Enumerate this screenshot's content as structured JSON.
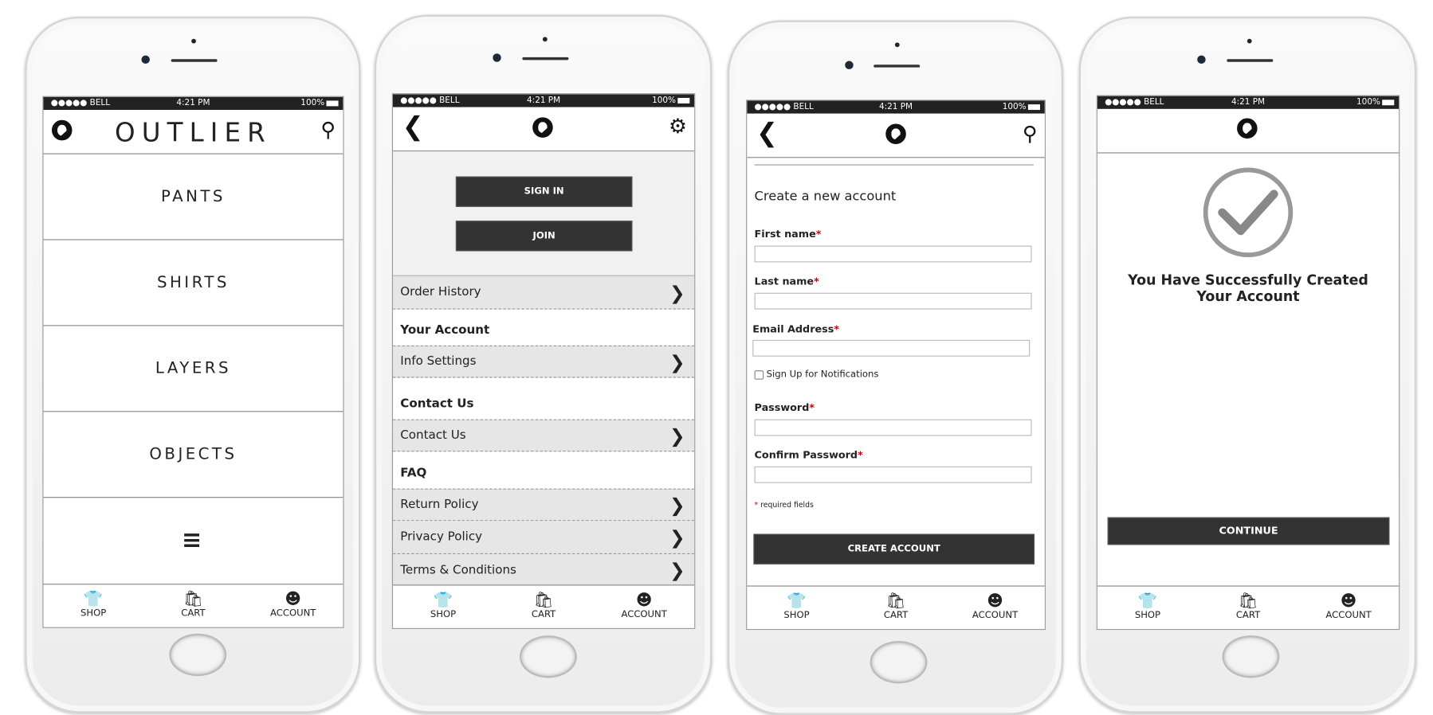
{
  "status_bar": {
    "carrier": "●●●●● BELL",
    "time": "4:21 PM",
    "battery": "100%"
  },
  "home": {
    "brand": "OUTLIER",
    "categories": [
      "PANTS",
      "SHIRTS",
      "LAYERS",
      "OBJECTS"
    ]
  },
  "tabs": [
    {
      "label": "SHOP",
      "icon": "shirt-icon"
    },
    {
      "label": "CART",
      "icon": "bag-icon"
    },
    {
      "label": "ACCOUNT",
      "icon": "user-icon"
    }
  ],
  "account": {
    "sign_in": "SIGN IN",
    "join": "JOIN",
    "order_history": "Order History",
    "your_account": "Your Account",
    "info_settings": "Info Settings",
    "contact_header": "Contact Us",
    "contact_us": "Contact Us",
    "faq": "FAQ",
    "return_policy": "Return Policy",
    "privacy_policy": "Privacy Policy",
    "terms": "Terms & Conditions"
  },
  "register": {
    "title": "Create a new account",
    "first_name": "First name",
    "last_name": "Last name",
    "email": "Email Address",
    "req": "*",
    "notifications": "Sign Up for Notifications",
    "password": "Password",
    "confirm_password": "Confirm Password",
    "required_note": "required fields",
    "create": "CREATE ACCOUNT"
  },
  "success": {
    "line1": "You Have Successfully Created",
    "line2": "Your Account",
    "continue": "CONTINUE"
  }
}
